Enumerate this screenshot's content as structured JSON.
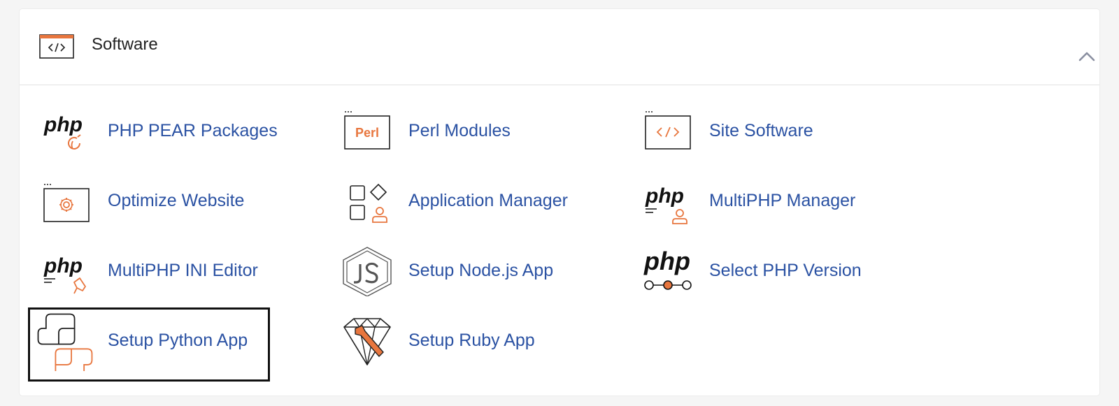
{
  "section": {
    "title": "Software",
    "icon": "code-window-icon",
    "collapse_icon": "chevron-up-icon"
  },
  "colors": {
    "accent": "#e8763e",
    "link": "#2b52a3",
    "text": "#222222"
  },
  "items": [
    {
      "label": "PHP PEAR Packages",
      "icon": "php-pear-icon"
    },
    {
      "label": "Perl Modules",
      "icon": "perl-icon",
      "icon_text": "Perl"
    },
    {
      "label": "Site Software",
      "icon": "site-software-icon"
    },
    {
      "label": "Optimize Website",
      "icon": "optimize-website-icon"
    },
    {
      "label": "Application Manager",
      "icon": "application-manager-icon"
    },
    {
      "label": "MultiPHP Manager",
      "icon": "multiphp-manager-icon"
    },
    {
      "label": "MultiPHP INI Editor",
      "icon": "multiphp-ini-editor-icon"
    },
    {
      "label": "Setup Node.js App",
      "icon": "nodejs-icon"
    },
    {
      "label": "Select PHP Version",
      "icon": "select-php-version-icon"
    },
    {
      "label": "Setup Python App",
      "icon": "python-icon"
    },
    {
      "label": "Setup Ruby App",
      "icon": "ruby-icon"
    }
  ],
  "php_text": "php"
}
